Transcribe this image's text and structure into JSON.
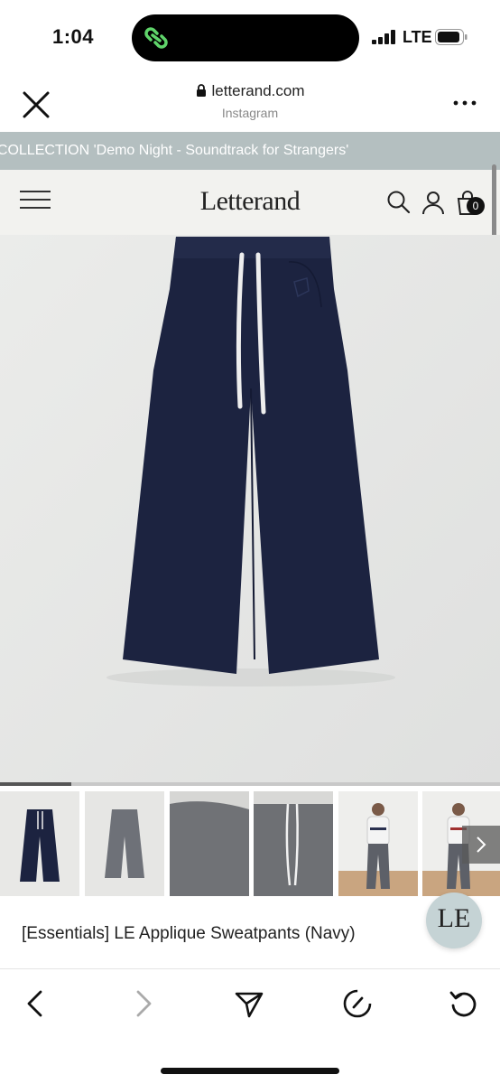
{
  "status_bar": {
    "time": "1:04",
    "network": "LTE",
    "app_icon": "link-icon"
  },
  "browser": {
    "domain": "letterand.com",
    "subtitle": "Instagram"
  },
  "banner": {
    "text": "/ COLLECTION 'Demo Night - Soundtrack for Strangers'"
  },
  "site": {
    "logo": "Letterand",
    "cart_count": "0"
  },
  "gallery": {
    "position": 1,
    "total": 7,
    "thumbnail_count": 6
  },
  "product": {
    "name": "[Essentials] LE Applique Sweatpants (Navy)"
  },
  "chat_badge": {
    "label": "LE"
  },
  "colors": {
    "banner": "#b4bfc0",
    "header": "#f2f2ef",
    "navy": "#1c2340",
    "background": "#e6e7e6"
  },
  "toolbar": {
    "items": [
      "back-icon",
      "forward-icon",
      "share-icon",
      "speed-icon",
      "refresh-icon"
    ]
  }
}
